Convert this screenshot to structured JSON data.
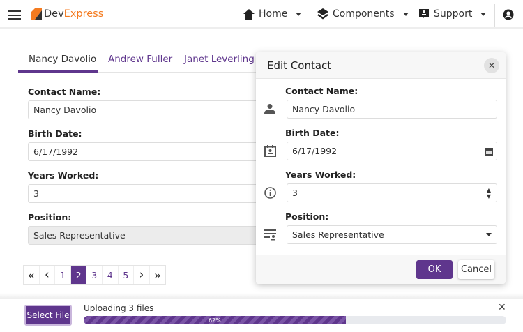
{
  "header": {
    "logo_dev": "Dev",
    "logo_express": "Express",
    "nav": [
      {
        "label": "Home",
        "icon": "home-icon"
      },
      {
        "label": "Components",
        "icon": "layers-icon"
      },
      {
        "label": "Support",
        "icon": "support-icon"
      }
    ],
    "account_icon": "account-circle-icon"
  },
  "tabs": [
    {
      "label": "Nancy Davolio",
      "active": true
    },
    {
      "label": "Andrew Fuller"
    },
    {
      "label": "Janet Leverling"
    }
  ],
  "form": {
    "fields": [
      {
        "label": "Contact Name:",
        "value": "Nancy Davolio"
      },
      {
        "label": "Birth Date:",
        "value": "6/17/1992"
      },
      {
        "label": "Years Worked:",
        "value": "3"
      },
      {
        "label": "Position:",
        "value": "Sales Representative"
      }
    ]
  },
  "pager": {
    "first": "«",
    "prev": "‹",
    "pages": [
      "1",
      "2",
      "3",
      "4",
      "5"
    ],
    "current": "2",
    "next": "›",
    "last": "»"
  },
  "modal": {
    "title": "Edit Contact",
    "close": "✕",
    "fields": [
      {
        "label": "Contact Name:",
        "value": "Nancy Davolio",
        "icon": "person-icon"
      },
      {
        "label": "Birth Date:",
        "value": "6/17/1992",
        "icon": "calendar-contact-icon"
      },
      {
        "label": "Years Worked:",
        "value": "3",
        "icon": "info-icon"
      },
      {
        "label": "Position:",
        "value": "Sales Representative",
        "icon": "list-person-icon"
      }
    ],
    "ok": "OK",
    "cancel": "Cancel"
  },
  "upload": {
    "button": "Select File",
    "status": "Uploading 3 files",
    "progress_percent": 62,
    "progress_label": "62%",
    "close": "✕"
  },
  "colors": {
    "accent": "#5f368d",
    "logo_orange": "#f47b20"
  }
}
